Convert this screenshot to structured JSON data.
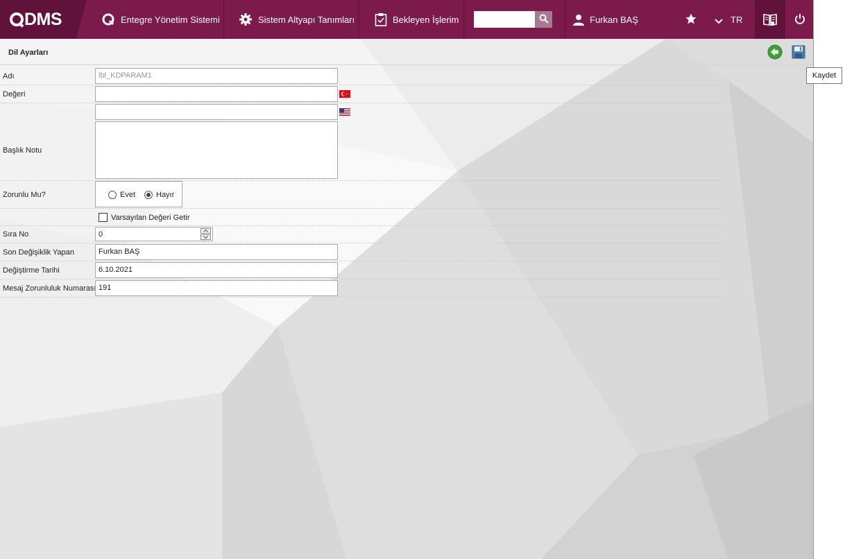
{
  "topbar": {
    "logo_text": "DMS",
    "nav_items": [
      {
        "label": "Entegre Yönetim Sistemi",
        "icon": "qdms-circle-icon"
      },
      {
        "label": "Sistem Altyapı Tanımları",
        "icon": "gear-icon"
      },
      {
        "label": "Bekleyen İşlerim",
        "icon": "clipboard-check-icon"
      }
    ],
    "search": {
      "value": "",
      "placeholder": ""
    },
    "user_name": "Furkan BAŞ",
    "language": "TR"
  },
  "page": {
    "title": "Dil Ayarları",
    "tooltip": "Kaydet"
  },
  "form": {
    "adi": {
      "label": "Adı",
      "value": "lbl_KDPARAM1"
    },
    "degeri": {
      "label": "Değeri",
      "value_tr": "",
      "value_en": ""
    },
    "baslik_notu": {
      "label": "Başlık Notu",
      "value": ""
    },
    "zorunlu": {
      "label": "Zorunlu Mu?",
      "option_yes": "Evet",
      "option_no": "Hayır",
      "selected": "Hayır"
    },
    "varsayilan": {
      "label": "Varsayılan Değeri Getir",
      "checked": false
    },
    "sira_no": {
      "label": "Sıra No",
      "value": "0"
    },
    "son_degisiklik": {
      "label": "Son Değişiklik Yapan",
      "value": "Furkan BAŞ"
    },
    "degistirme_tarihi": {
      "label": "Değiştirme Tarihi",
      "value": "6.10.2021"
    },
    "mesaj_no": {
      "label": "Mesaj Zorunluluk Numarası",
      "value": "191"
    }
  },
  "colors": {
    "topbar": "#7b1a4b",
    "topbar_dark": "#61123a",
    "back_button": "#3aa335",
    "save_button": "#4a7fb5"
  }
}
